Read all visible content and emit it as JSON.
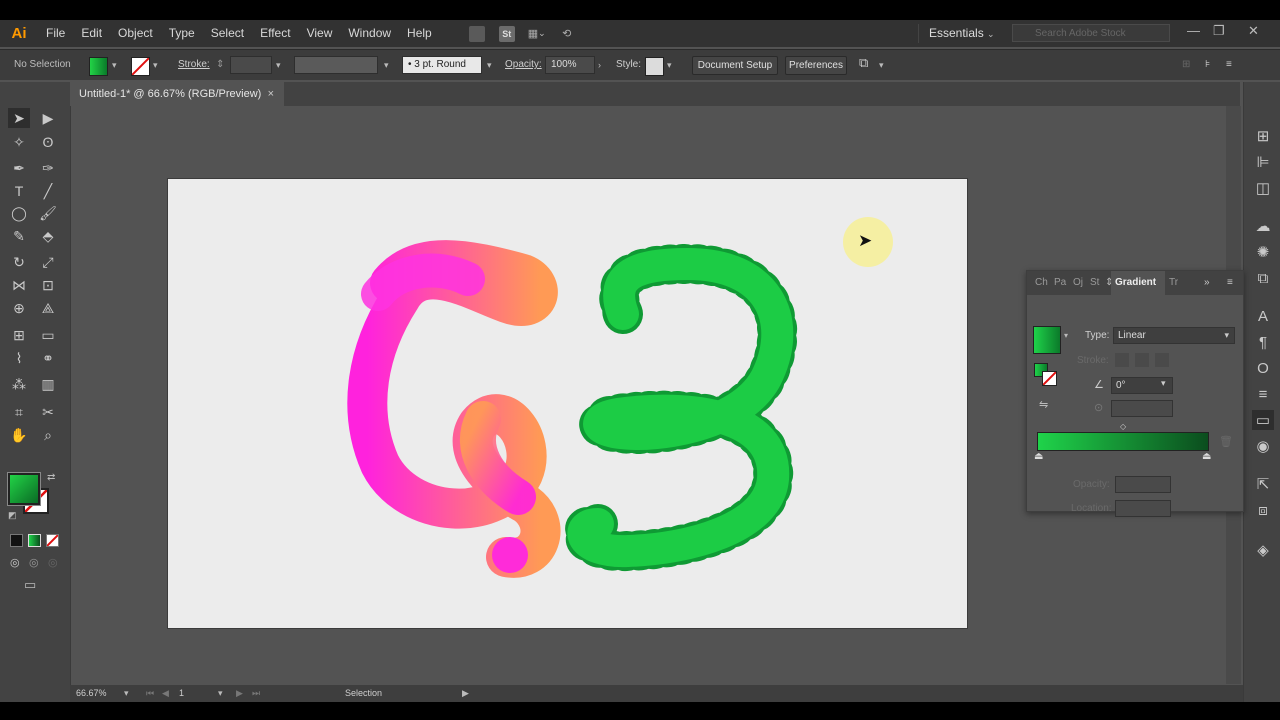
{
  "app": {
    "logo": "Ai"
  },
  "menu": {
    "items": [
      "File",
      "Edit",
      "Object",
      "Type",
      "Select",
      "Effect",
      "View",
      "Window",
      "Help"
    ]
  },
  "menubar_right": {
    "st_badge": "St",
    "workspace": "Essentials",
    "search_placeholder": "Search Adobe Stock"
  },
  "control_bar": {
    "selection_status": "No Selection",
    "stroke_label": "Stroke:",
    "brush_label": "3 pt. Round",
    "opacity_label": "Opacity:",
    "opacity_value": "100%",
    "style_label": "Style:",
    "document_setup": "Document Setup",
    "preferences": "Preferences"
  },
  "document": {
    "tab_title": "Untitled-1* @ 66.67% (RGB/Preview)",
    "close": "×"
  },
  "gradient_panel": {
    "tabs": [
      "Ch",
      "Pa",
      "Oj",
      "St",
      "Gradient",
      "Tr"
    ],
    "active_tab": "Gradient",
    "type_label": "Type:",
    "type_value": "Linear",
    "stroke_label": "Stroke:",
    "angle_value": "0°",
    "opacity_label": "Opacity:",
    "location_label": "Location:",
    "ramp_colors": [
      "#1fd34a",
      "#0b4d1e"
    ]
  },
  "status_bar": {
    "zoom": "66.67%",
    "artboard_number": "1",
    "tool_name": "Selection"
  },
  "colors": {
    "fill_swatch": "#16a33b",
    "letter_g_colors": [
      "#ff22dd",
      "#ff9a55"
    ],
    "letter_b_colors": [
      "#22dd44",
      "#0a7a2a"
    ],
    "pointer_highlight": "#f7f096"
  }
}
